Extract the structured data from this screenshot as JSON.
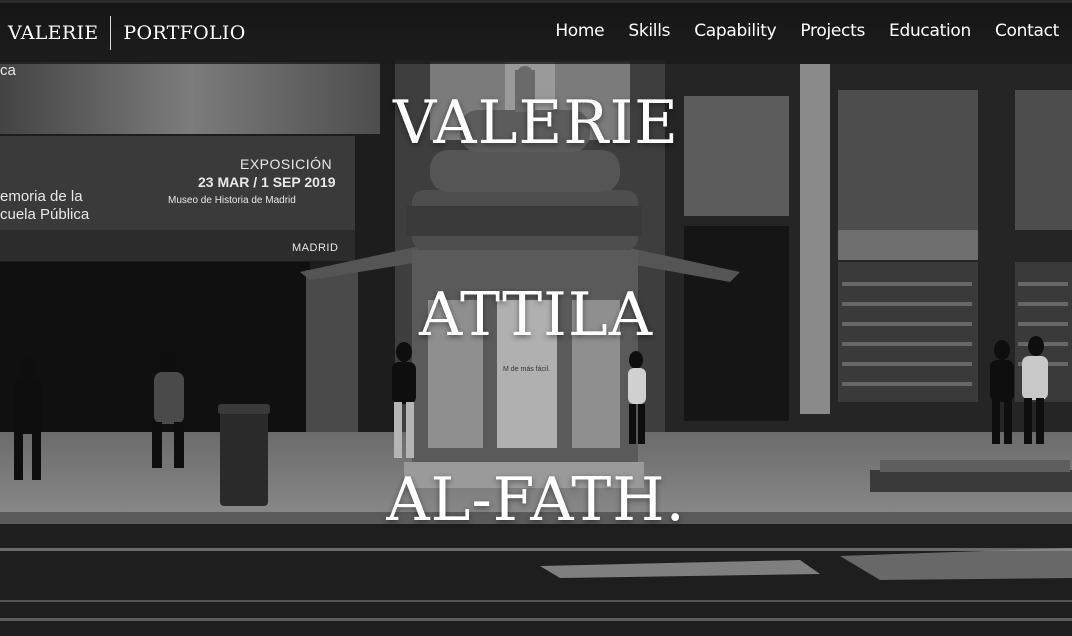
{
  "brand": {
    "first": "VALERIE",
    "second": "PORTFOLIO"
  },
  "nav": {
    "items": [
      "Home",
      "Skills",
      "Capability",
      "Projects",
      "Education",
      "Contact"
    ]
  },
  "hero": {
    "title_lines": [
      "VALERIE",
      "ATTILA",
      "AL-FATH."
    ],
    "background_text": {
      "corner": "ca",
      "exhibit_label": "EXPOSICIÓN",
      "exhibit_dates": "23 MAR / 1 SEP 2019",
      "exhibit_museum": "Museo de Historia de Madrid",
      "exhibit_title_1": "emoria de la",
      "exhibit_title_2": "cuela Pública",
      "city": "MADRID",
      "kiosk_poster": "M de más fácil."
    }
  },
  "colors": {
    "text": "#ffffff",
    "navbar": "#161616"
  }
}
